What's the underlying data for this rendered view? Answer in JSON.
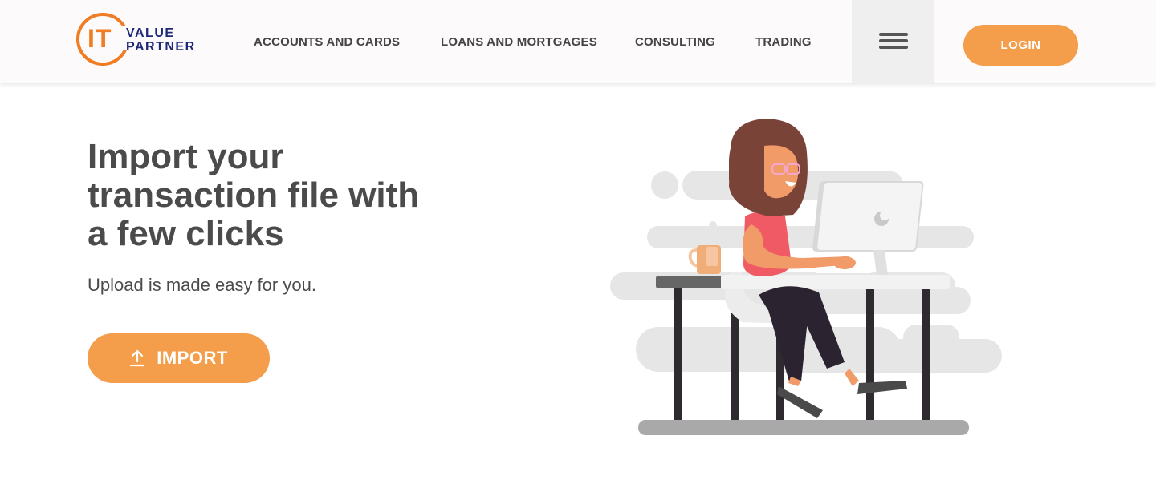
{
  "brand": {
    "logo_mark": "IT",
    "logo_word_1": "VALUE",
    "logo_word_2": "PARTNER",
    "accent_color": "#f07d23",
    "navy_color": "#1e2a78"
  },
  "nav": {
    "items": [
      {
        "label": "ACCOUNTS AND CARDS"
      },
      {
        "label": "LOANS AND MORTGAGES"
      },
      {
        "label": "CONSULTING"
      },
      {
        "label": "TRADING"
      }
    ],
    "menu_icon": "hamburger-icon",
    "login_label": "LOGIN"
  },
  "hero": {
    "title_lines": [
      "Import your",
      "transaction file with",
      "a few clicks"
    ],
    "subtitle": "Upload is made easy for you.",
    "button_label": "IMPORT",
    "button_icon": "upload-icon",
    "button_color": "#f49d4a"
  },
  "illustration": {
    "icon": "woman-at-computer-illustration"
  }
}
